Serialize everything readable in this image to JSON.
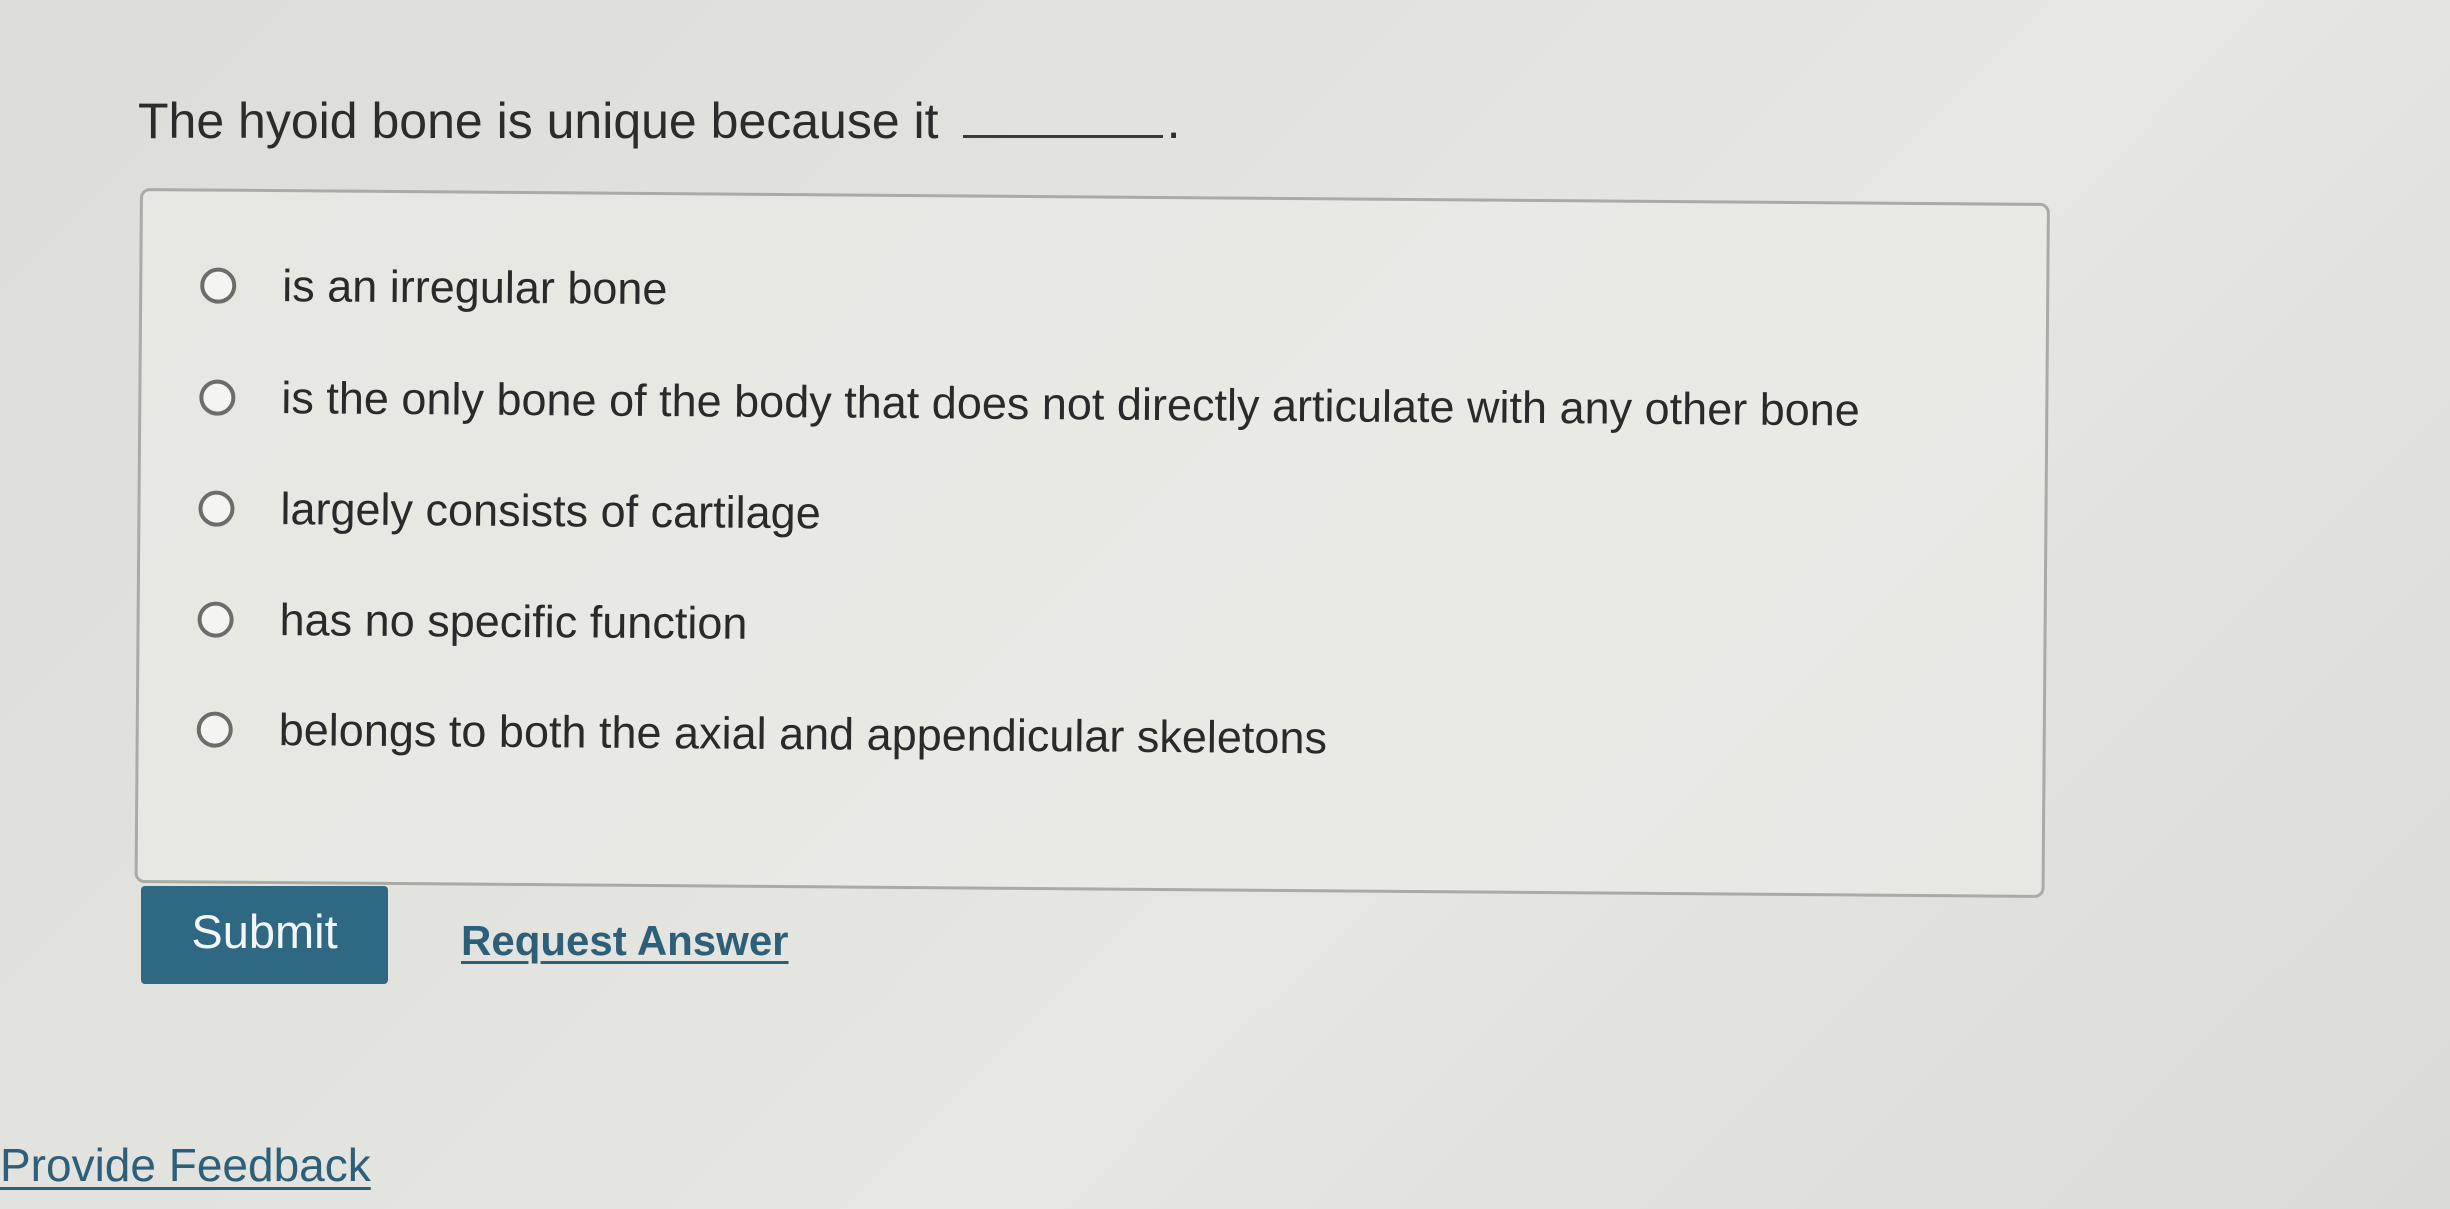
{
  "question": {
    "text": "The hyoid bone is unique because it",
    "end": "."
  },
  "options": [
    {
      "label": "is an irregular bone",
      "selected": false
    },
    {
      "label": "is the only bone of the body that does not directly articulate with any other bone",
      "selected": false
    },
    {
      "label": "largely consists of cartilage",
      "selected": false
    },
    {
      "label": "has no specific function",
      "selected": false
    },
    {
      "label": "belongs to both the axial and appendicular skeletons",
      "selected": false
    }
  ],
  "actions": {
    "submit_label": "Submit",
    "request_answer_label": "Request Answer"
  },
  "footer": {
    "feedback_label": "Provide Feedback"
  },
  "colors": {
    "submit_bg": "#2f6882",
    "link": "#2d5f78"
  }
}
